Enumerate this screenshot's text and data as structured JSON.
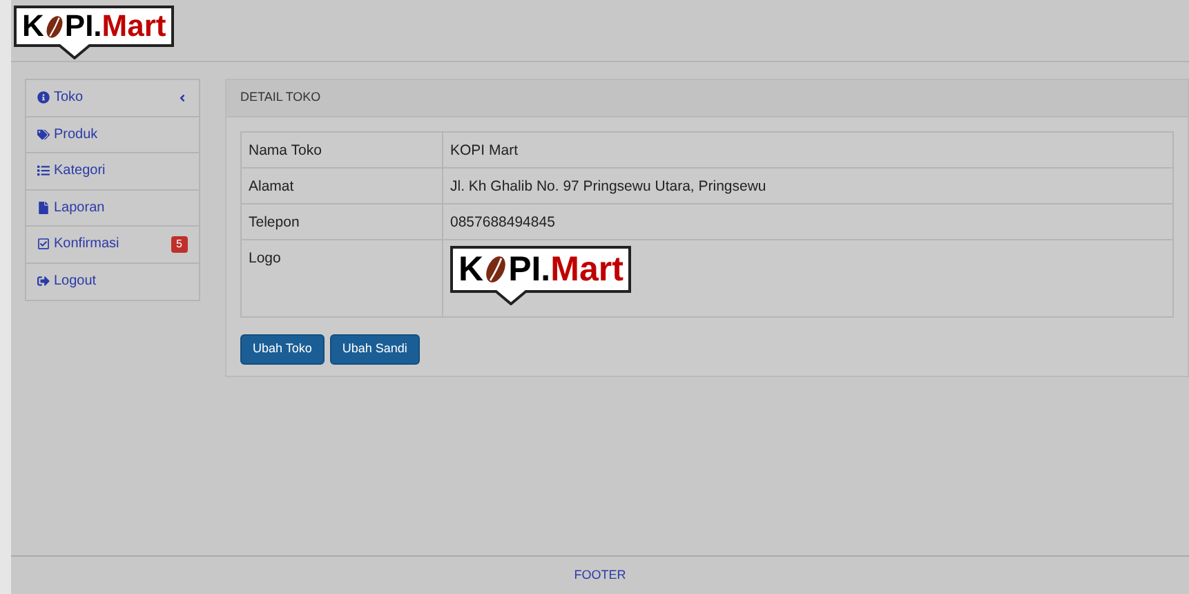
{
  "header": {
    "logo": {
      "first": "K",
      "rest": "PI.",
      "accent": "Mart"
    }
  },
  "sidebar": {
    "items": [
      {
        "label": "Toko",
        "selected": false,
        "expandable": true
      },
      {
        "label": "Produk",
        "selected": false
      },
      {
        "label": "Kategori",
        "selected": false
      },
      {
        "label": "Laporan",
        "selected": false
      },
      {
        "label": "Konfirmasi",
        "selected": false,
        "badge": "5"
      },
      {
        "label": "Logout",
        "selected": false
      }
    ]
  },
  "panel": {
    "title": "DETAIL TOKO",
    "rows": [
      {
        "kind": "text",
        "label": "Nama Toko",
        "value": "KOPI Mart"
      },
      {
        "kind": "text",
        "label": "Alamat",
        "value": "Jl. Kh Ghalib No. 97 Pringsewu Utara, Pringsewu"
      },
      {
        "kind": "text",
        "label": "Telepon",
        "value": "0857688494845"
      },
      {
        "kind": "logo",
        "label": "Logo",
        "logo": {
          "first": "K",
          "rest": "PI.",
          "accent": "Mart"
        }
      }
    ],
    "buttons": [
      "Ubah Toko",
      "Ubah Sandi"
    ]
  },
  "footer": {
    "text": "FOOTER"
  }
}
